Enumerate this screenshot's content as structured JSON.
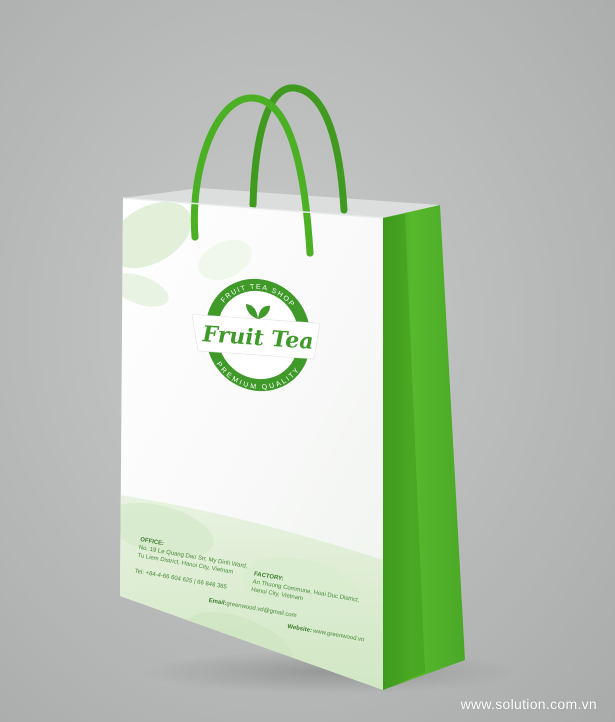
{
  "logo": {
    "arc_top": "FRUIT TEA SHOP",
    "name": "Fruit Tea",
    "arc_bottom": "PREMIUM QUALITY",
    "stars": "★ ★ ★"
  },
  "office": {
    "heading": "OFFICE:",
    "line1": "No. 19 Le Quang Dao Str, My Dinh Ward,",
    "line2": "Tu Liem District, Hanoi City, Vietnam",
    "phone": "Tel: +84-4-66 604 625 | 66 848 365",
    "email_label": "Email:",
    "email": "greenwood.vd@gmail.com"
  },
  "factory": {
    "heading": "FACTORY:",
    "line1": "An Thuong Commune, Hoai Duc District,",
    "line2": "Hanoi City, Vietnam",
    "website_label": "Website:",
    "website": "www.greenwood.vn"
  },
  "watermark": "www.solution.com.vn",
  "colors": {
    "bag_green": "#4fb32a",
    "bag_green_dark": "#3e9a1f",
    "logo_green": "#3f9a2a",
    "background": "#bfc1c1"
  }
}
